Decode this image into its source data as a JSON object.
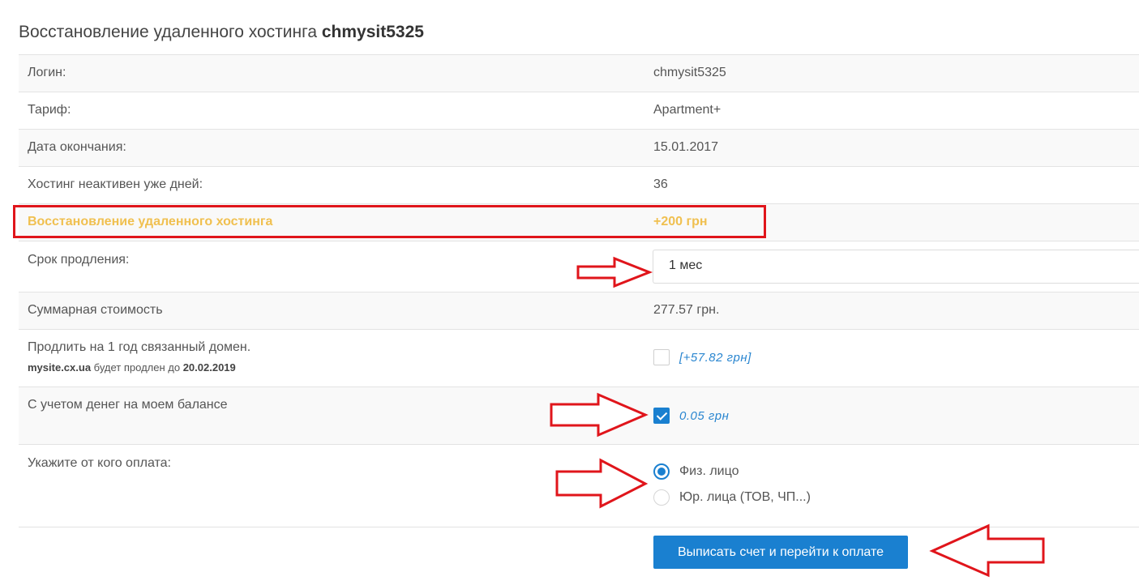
{
  "header": {
    "title_prefix": "Восстановление удаленного хостинга",
    "title_login": "chmysit5325"
  },
  "rows": {
    "login": {
      "label": "Логин:",
      "value": "chmysit5325"
    },
    "tariff": {
      "label": "Тариф:",
      "value": "Apartment+"
    },
    "end_date": {
      "label": "Дата окончания:",
      "value": "15.01.2017"
    },
    "inactive_days": {
      "label": "Хостинг неактивен уже дней:",
      "value": "36"
    },
    "restore_fee": {
      "label": "Восстановление удаленного хостинга",
      "value": "+200 грн"
    },
    "period": {
      "label": "Срок продления:",
      "selected": "1 мес"
    },
    "total": {
      "label": "Суммарная стоимость",
      "value": "277.57 грн."
    },
    "domain": {
      "label": "Продлить на 1 год связанный домен.",
      "domain_name": "mysite.cx.ua",
      "note_middle": "будет продлен до",
      "renew_date": "20.02.2019",
      "price": "[+57.82 грн]",
      "checked": false
    },
    "balance": {
      "label": "С учетом денег на моем балансе",
      "amount": "0.05 грн",
      "checked": true
    },
    "payer": {
      "label": "Укажите от кого оплата:",
      "options": [
        "Физ. лицо",
        "Юр. лица (ТОВ, ЧП...)"
      ],
      "selected_index": 0
    }
  },
  "actions": {
    "submit_label": "Выписать счет и перейти к оплате"
  },
  "colors": {
    "accent": "#1a80d0",
    "highlight_text": "#f0c050",
    "annotation_red": "#e0151b"
  }
}
